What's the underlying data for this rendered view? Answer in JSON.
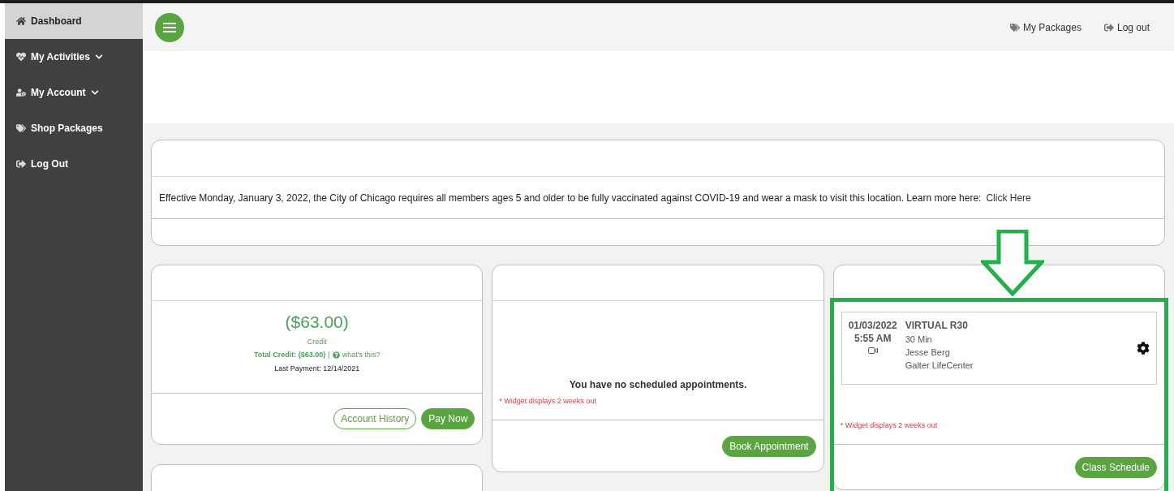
{
  "sidebar": {
    "items": [
      {
        "label": "Dashboard",
        "selected": true,
        "expandable": false
      },
      {
        "label": "My Activities",
        "selected": false,
        "expandable": true
      },
      {
        "label": "My Account",
        "selected": false,
        "expandable": true
      },
      {
        "label": "Shop Packages",
        "selected": false,
        "expandable": false
      },
      {
        "label": "Log Out",
        "selected": false,
        "expandable": false
      }
    ]
  },
  "topbar": {
    "links": [
      "My Packages",
      "Log out"
    ]
  },
  "announcement": {
    "text": "Effective Monday, January 3, 2022, the City of Chicago requires all members ages 5 and older to be fully vaccinated against COVID-19 and wear a mask to visit this location. Learn more here:",
    "link": "Click Here"
  },
  "account_card": {
    "amount": "($63.00)",
    "amount_label": "Credit",
    "total_credit": "Total Credit: ($63.00)",
    "separator": "|",
    "help_link": "what's this?",
    "last_payment": "Last Payment: 12/14/2021",
    "buttons": [
      {
        "label": "Account History",
        "kind": "outline"
      },
      {
        "label": "Pay Now",
        "kind": "filled"
      }
    ]
  },
  "appointments_card": {
    "message": "You have no scheduled appointments.",
    "note": "* Widget displays 2 weeks out",
    "buttons": [
      {
        "label": "Book Appointment",
        "kind": "filled"
      }
    ]
  },
  "classes_card": {
    "classes": [
      {
        "date": "01/03/2022",
        "time": "5:55 AM",
        "virtual": true,
        "name": "VIRTUAL R30",
        "duration": "30 Min",
        "instructor": "Jesse Berg",
        "location": "Galter LifeCenter"
      }
    ],
    "note": "* Widget displays 2 weeks out",
    "buttons": [
      {
        "label": "Class Schedule",
        "kind": "filled"
      }
    ]
  }
}
